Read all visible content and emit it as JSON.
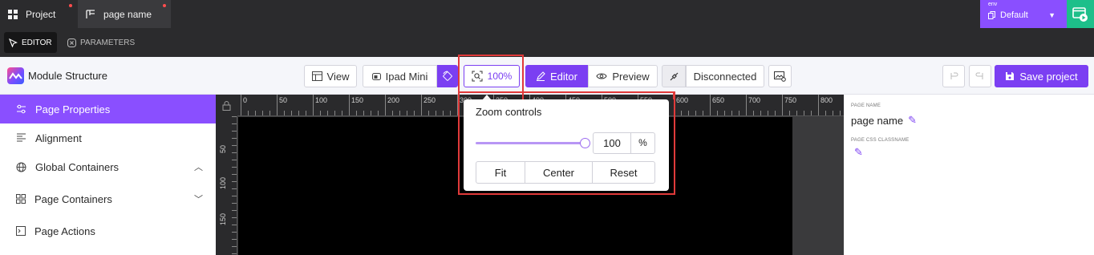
{
  "topbar": {
    "tabs": [
      {
        "label": "Project"
      },
      {
        "label": "page name"
      }
    ],
    "env": {
      "small_label": "env",
      "value": "Default"
    }
  },
  "subbar": {
    "editor_label": "EDITOR",
    "parameters_label": "PARAMETERS"
  },
  "toolbar": {
    "module_title": "Module Structure",
    "view_label": "View",
    "device_label": "Ipad Mini",
    "zoom_label": "100%",
    "editor_label": "Editor",
    "preview_label": "Preview",
    "connection_label": "Disconnected",
    "save_label": "Save project"
  },
  "sidebar": {
    "items": [
      {
        "label": "Page Properties",
        "icon": "gear-sliders-icon"
      },
      {
        "label": "Alignment",
        "icon": "align-icon"
      },
      {
        "label": "Global Containers",
        "icon": "globe-icon"
      },
      {
        "label": "Page Containers",
        "icon": "grid-icon"
      },
      {
        "label": "Page Actions",
        "icon": "terminal-icon"
      }
    ]
  },
  "ruler": {
    "top_labels": [
      "0",
      "50",
      "100",
      "150",
      "200",
      "250",
      "300",
      "350",
      "400",
      "450",
      "500",
      "550",
      "600",
      "650",
      "700",
      "750",
      "800"
    ],
    "left_labels": [
      "50",
      "100",
      "150"
    ]
  },
  "zoom_popover": {
    "title": "Zoom controls",
    "value": "100",
    "unit": "%",
    "slider_fraction": 1.0,
    "buttons": [
      "Fit",
      "Center",
      "Reset"
    ]
  },
  "properties": {
    "page_name_label": "PAGE NAME",
    "page_name_value": "page name",
    "css_label": "PAGE CSS CLASSNAME"
  },
  "colors": {
    "accent": "#7b3ff2",
    "highlight": "#e03a3a",
    "env_bg": "#8a4fff",
    "launch_bg": "#1dbf8a"
  }
}
